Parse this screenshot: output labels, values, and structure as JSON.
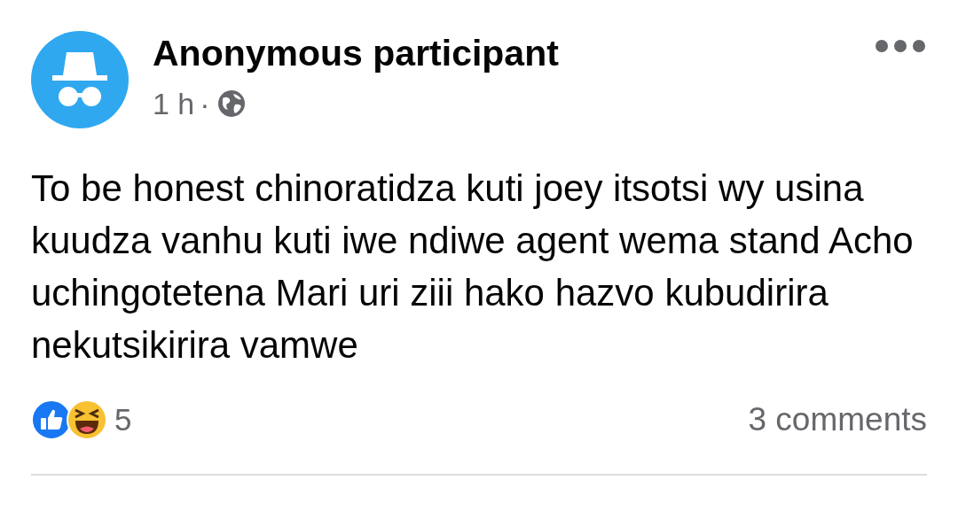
{
  "post": {
    "author": "Anonymous participant",
    "time": "1 h",
    "separator": "·",
    "audience_icon": {
      "kind": "globe"
    },
    "text": "To be honest chinoratidza kuti joey itsotsi wy usina kuudza vanhu kuti iwe ndiwe agent wema stand Acho uchingotetena Mari uri ziii hako hazvo kubudirira nekutsikirira vamwe",
    "reactions": {
      "icons": [
        {
          "kind": "like"
        },
        {
          "kind": "haha"
        }
      ],
      "count": "5"
    },
    "comments": "3 comments"
  }
}
